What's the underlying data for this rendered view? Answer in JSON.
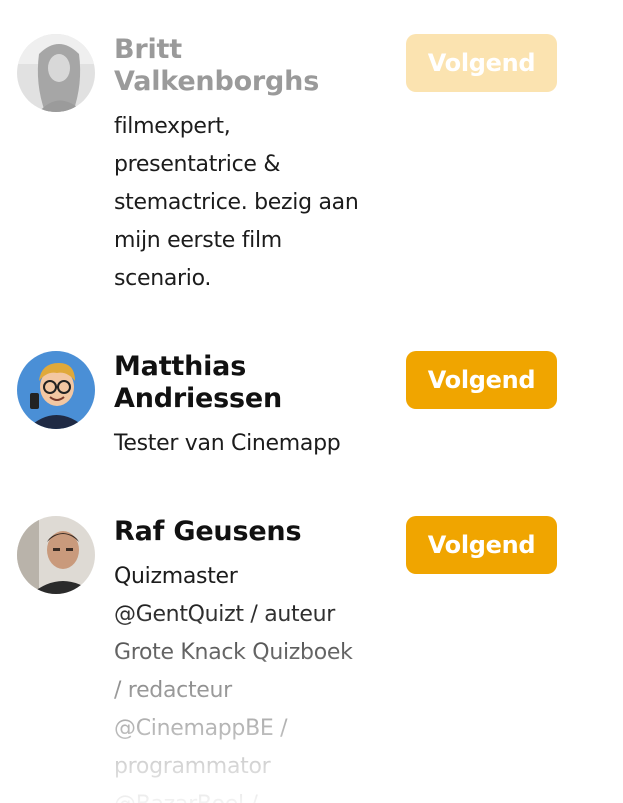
{
  "users": [
    {
      "name_line1": "Britt",
      "name_line2": "Valkenborghs",
      "bio_lines": [
        "filmexpert,",
        "presentatrice &",
        "stemactrice. bezig aan",
        "mijn eerste film",
        "scenario."
      ],
      "button_label": "Volgend"
    },
    {
      "name_line1": "Matthias",
      "name_line2": "Andriessen",
      "bio_lines": [
        "Tester van Cinemapp"
      ],
      "button_label": "Volgend"
    },
    {
      "name_line1": "Raf Geusens",
      "bio_lines": [
        "Quizmaster",
        "@GentQuizt / auteur",
        "Grote Knack Quizboek",
        "/ redacteur",
        "@CinemappBE /",
        "programmator",
        "@BazarBoel /"
      ],
      "button_label": "Volgend"
    }
  ],
  "colors": {
    "accent": "#f0a500",
    "accent_faded": "#fbe3b0",
    "text": "#111111"
  }
}
